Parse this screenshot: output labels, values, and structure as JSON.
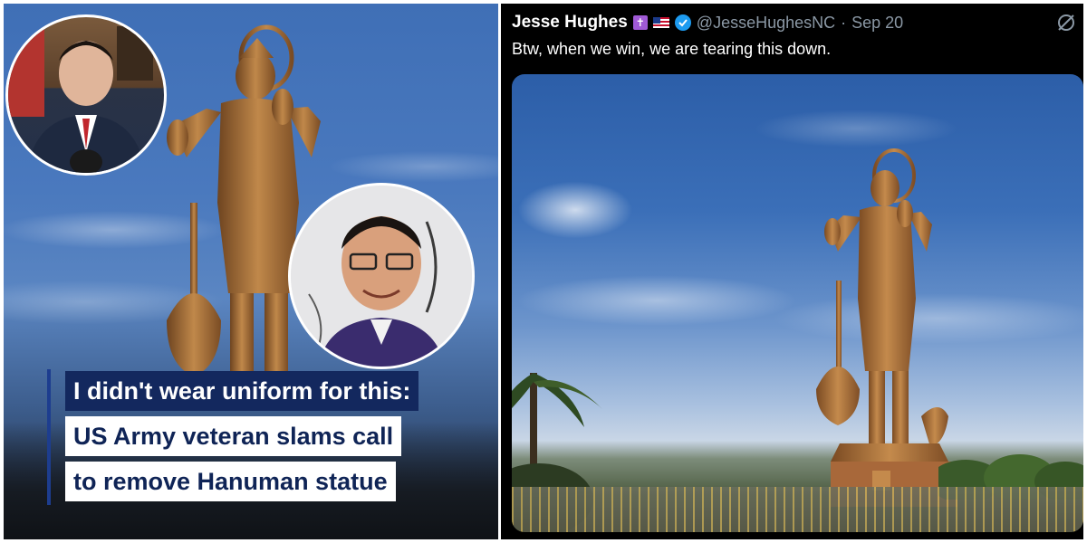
{
  "headline": {
    "line1": "I didn't wear uniform for this:",
    "line2": "US Army veteran slams call",
    "line3": "to remove Hanuman statue"
  },
  "tweet": {
    "author_name": "Jesse Hughes",
    "handle": "@JesseHughesNC",
    "separator": "·",
    "date": "Sep 20",
    "text": "Btw, when we win, we are tearing this down.",
    "emoji_cross": "✝",
    "icons": [
      "cross-emoji-icon",
      "us-flag-emoji-icon",
      "verified-badge-icon",
      "grok-icon"
    ]
  },
  "colors": {
    "headline_dark": "#13285e",
    "headline_text": "#0f2456",
    "verified_blue": "#1d9bf0",
    "handle_gray": "#8b98a5",
    "statue_bronze": "#b07a3c"
  }
}
